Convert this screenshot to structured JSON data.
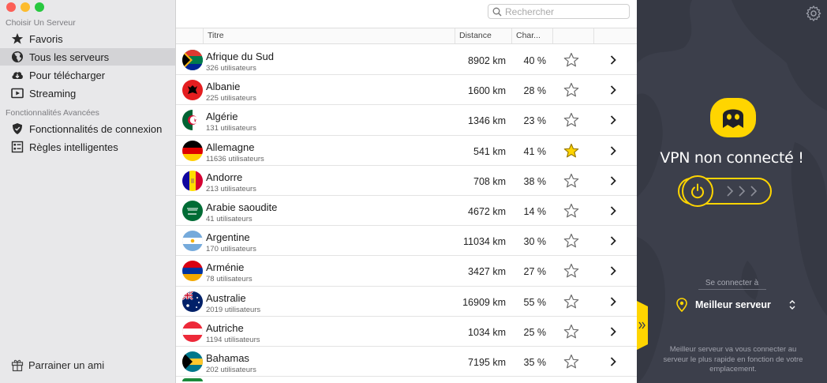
{
  "sidebar": {
    "section_choose": "Choisir Un Serveur",
    "items": [
      {
        "label": "Favoris",
        "icon": "star-icon"
      },
      {
        "label": "Tous les serveurs",
        "icon": "globe-icon"
      },
      {
        "label": "Pour télécharger",
        "icon": "cloud-download-icon"
      },
      {
        "label": "Streaming",
        "icon": "play-icon"
      }
    ],
    "section_advanced": "Fonctionnalités Avancées",
    "advanced_items": [
      {
        "label": "Fonctionnalités de connexion",
        "icon": "shield-icon"
      },
      {
        "label": "Règles intelligentes",
        "icon": "rules-icon"
      }
    ],
    "footer_label": "Parrainer un ami"
  },
  "search": {
    "placeholder": "Rechercher"
  },
  "table": {
    "headers": {
      "title": "Titre",
      "distance": "Distance",
      "load": "Char..."
    },
    "rows": [
      {
        "name": "Afrique du Sud",
        "users": "326 utilisateurs",
        "distance": "8902 km",
        "load": "40 %",
        "favorite": false
      },
      {
        "name": "Albanie",
        "users": "225 utilisateurs",
        "distance": "1600 km",
        "load": "28 %",
        "favorite": false
      },
      {
        "name": "Algérie",
        "users": "131 utilisateurs",
        "distance": "1346 km",
        "load": "23 %",
        "favorite": false
      },
      {
        "name": "Allemagne",
        "users": "11636 utilisateurs",
        "distance": "541 km",
        "load": "41 %",
        "favorite": true
      },
      {
        "name": "Andorre",
        "users": "213 utilisateurs",
        "distance": "708 km",
        "load": "38 %",
        "favorite": false
      },
      {
        "name": "Arabie saoudite",
        "users": "41 utilisateurs",
        "distance": "4672 km",
        "load": "14 %",
        "favorite": false
      },
      {
        "name": "Argentine",
        "users": "170 utilisateurs",
        "distance": "11034 km",
        "load": "30 %",
        "favorite": false
      },
      {
        "name": "Arménie",
        "users": "78 utilisateurs",
        "distance": "3427 km",
        "load": "27 %",
        "favorite": false
      },
      {
        "name": "Australie",
        "users": "2019 utilisateurs",
        "distance": "16909 km",
        "load": "55 %",
        "favorite": false
      },
      {
        "name": "Autriche",
        "users": "1194 utilisateurs",
        "distance": "1034 km",
        "load": "25 %",
        "favorite": false
      },
      {
        "name": "Bahamas",
        "users": "202 utilisateurs",
        "distance": "7195 km",
        "load": "35 %",
        "favorite": false
      }
    ]
  },
  "vpn": {
    "status": "VPN non connecté !",
    "connect_label": "Se connecter à",
    "server": "Meilleur serveur",
    "hint": "Meilleur serveur va vous connecter au serveur le plus rapide en fonction de votre emplacement.",
    "accent_color": "#ffd500",
    "panel_color": "#3c3f4b"
  }
}
